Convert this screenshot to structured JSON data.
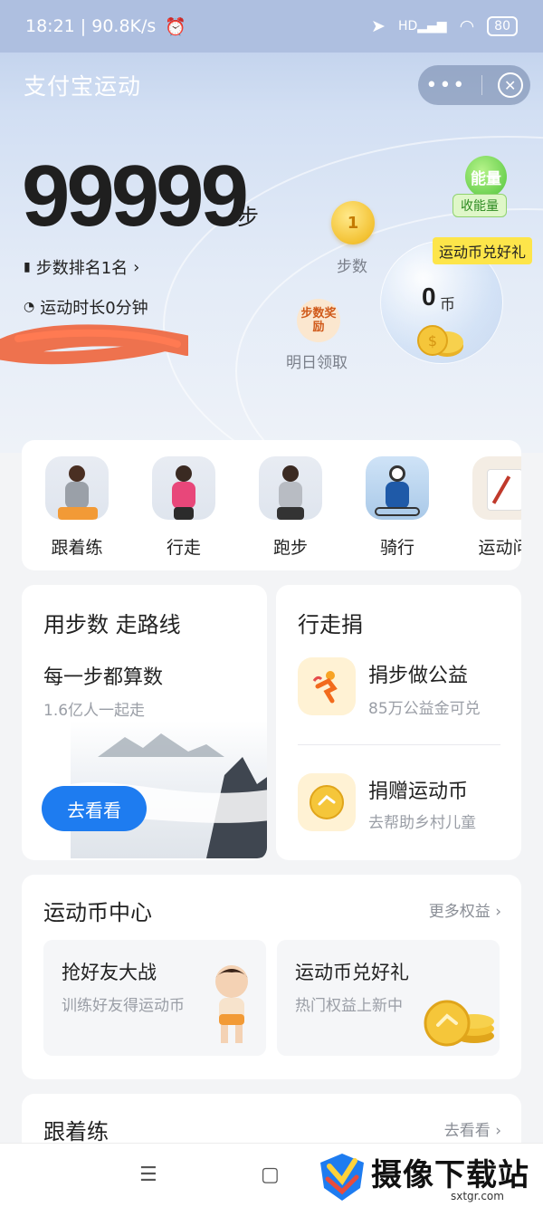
{
  "status_bar": {
    "time_speed": "18:21 | 90.8K/s",
    "network": "HD",
    "battery": "80"
  },
  "header": {
    "title": "支付宝运动"
  },
  "summary": {
    "steps": "99999",
    "steps_unit": "步",
    "rank": "步数排名1名",
    "duration": "运动时长0分钟",
    "step_coin_value": "1",
    "step_coin_label": "步数",
    "reward_badge": "步数奖励",
    "reward_label": "明日领取",
    "coin_amount": "0",
    "coin_unit": "币",
    "exchange_tag": "运动币兑好礼",
    "energy_badge": "能量",
    "energy_label": "收能量"
  },
  "categories": [
    {
      "label": "跟着练"
    },
    {
      "label": "行走"
    },
    {
      "label": "跑步"
    },
    {
      "label": "骑行"
    },
    {
      "label": "运动问"
    }
  ],
  "route_card": {
    "title": "用步数 走路线",
    "subtitle": "每一步都算数",
    "desc": "1.6亿人一起走",
    "button": "去看看"
  },
  "donate_card": {
    "title": "行走捐",
    "items": [
      {
        "title": "捐步做公益",
        "desc": "85万公益金可兑"
      },
      {
        "title": "捐赠运动币",
        "desc": "去帮助乡村儿童"
      }
    ]
  },
  "coin_center": {
    "title": "运动币中心",
    "more": "更多权益",
    "tiles": [
      {
        "title": "抢好友大战",
        "desc": "训练好友得运动币"
      },
      {
        "title": "运动币兑好礼",
        "desc": "热门权益上新中"
      }
    ]
  },
  "follow_section": {
    "title": "跟着练",
    "more": "去看看"
  },
  "watermark": {
    "text": "摄像下载站",
    "url": "sxtgr.com"
  },
  "colors": {
    "accent_blue": "#1e7cf0",
    "coin_gold": "#f3c233",
    "tag_yellow": "#fde54a"
  }
}
